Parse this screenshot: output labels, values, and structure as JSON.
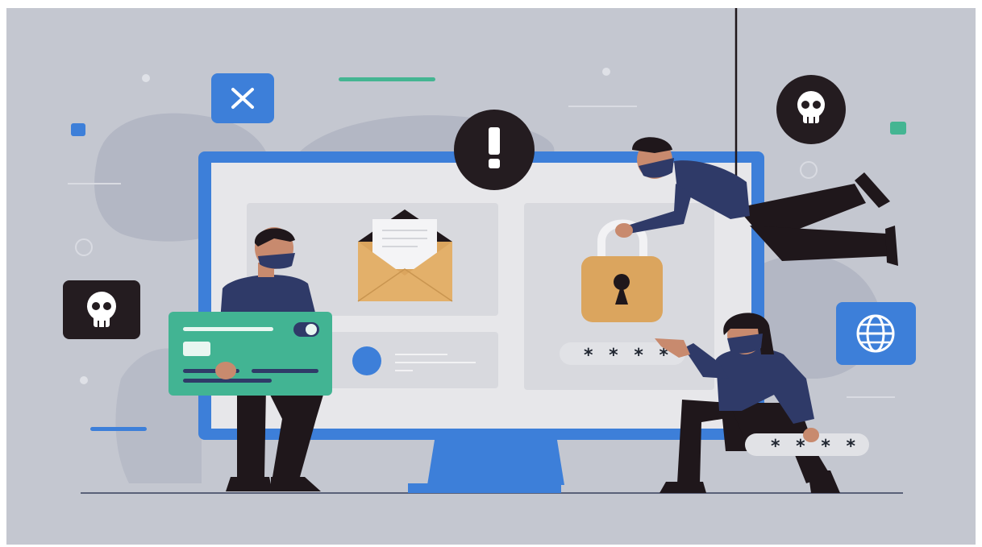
{
  "illustration": {
    "password_field_1": "* * * *",
    "password_field_2": "* * * *",
    "icons": [
      "close-icon",
      "alert-icon",
      "skull-icon",
      "skull-icon",
      "globe-icon",
      "envelope-icon",
      "padlock-icon",
      "credit-card-icon"
    ],
    "colors": {
      "background": "#c4c7d0",
      "monitor_blue": "#3d7fd9",
      "screen": "#e7e7ea",
      "card_green": "#42b493",
      "lock_orange": "#dba55e",
      "hoodie_navy": "#2f3a68",
      "pants_dark": "#1f171b",
      "badge_dark": "#241c20",
      "skin": "#c88a6e"
    }
  }
}
